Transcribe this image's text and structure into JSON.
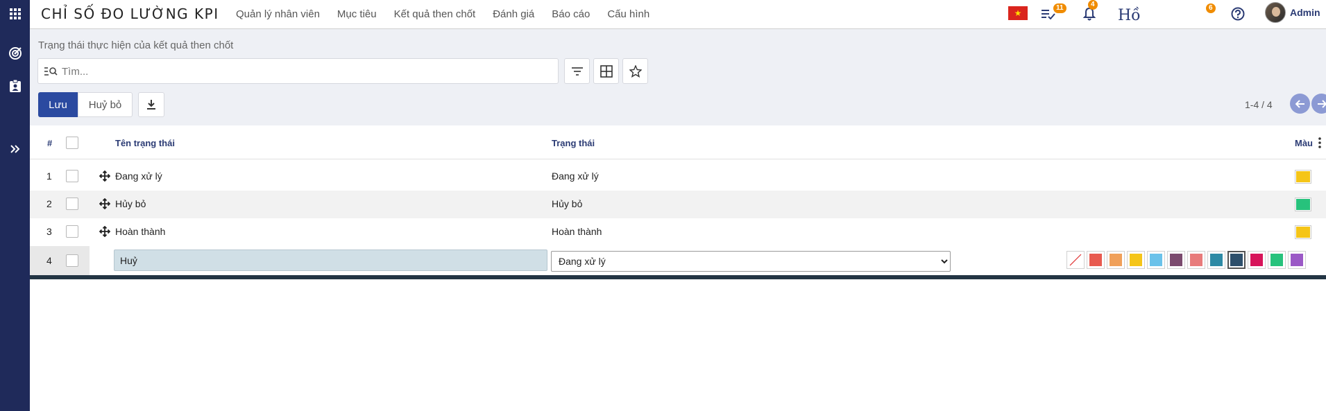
{
  "app": {
    "title": "CHỈ SỐ ĐO LƯỜNG KPI"
  },
  "nav": [
    "Quản lý nhân viên",
    "Mục tiêu",
    "Kết quả then chốt",
    "Đánh giá",
    "Báo cáo",
    "Cấu hình"
  ],
  "header": {
    "tasks_count": "11",
    "notifications_count": "4",
    "ho_text": "Hồ",
    "messages_count": "6",
    "user_name": "Admin"
  },
  "breadcrumb": "Trạng thái thực hiện của kết quả then chốt",
  "search": {
    "placeholder": "Tìm..."
  },
  "actions": {
    "save_label": "Lưu",
    "cancel_label": "Huỷ bỏ"
  },
  "pager": {
    "text": "1-4 / 4"
  },
  "table": {
    "columns": {
      "index": "#",
      "name": "Tên trạng thái",
      "status": "Trạng thái",
      "color": "Màu"
    },
    "rows": [
      {
        "num": "1",
        "name": "Đang xử lý",
        "status": "Đang xử lý",
        "color": "#f5c518"
      },
      {
        "num": "2",
        "name": "Hủy bỏ",
        "status": "Hủy bỏ",
        "color": "#27c27c"
      },
      {
        "num": "3",
        "name": "Hoàn thành",
        "status": "Hoàn thành",
        "color": "#f5c518"
      }
    ],
    "edit_row": {
      "num": "4",
      "name_value": "Huỷ",
      "status_options": [
        "Đang xử lý"
      ],
      "status_selected": "Đang xử lý",
      "palette": [
        "none",
        "#e85a4f",
        "#f0a05a",
        "#f5c518",
        "#6bc2ea",
        "#7b4a6e",
        "#e87b7b",
        "#2e8aa5",
        "#2d4f6b",
        "#d7145a",
        "#27c27c",
        "#9b59c6"
      ],
      "selected_color": "#2d4f6b"
    }
  }
}
